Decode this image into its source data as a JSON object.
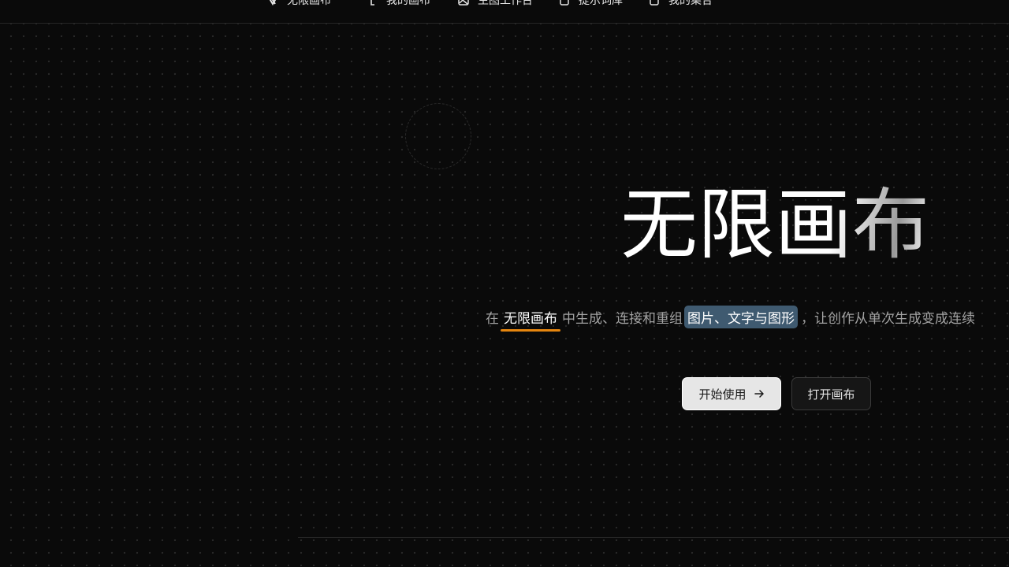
{
  "nav": {
    "items": [
      {
        "label": "无限画布",
        "icon": "logo-icon"
      },
      {
        "label": "我的画布",
        "icon": "bracket-icon"
      },
      {
        "label": "生图工作台",
        "icon": "image-icon"
      },
      {
        "label": "提示词库",
        "icon": "notebook-icon"
      },
      {
        "label": "我的集合",
        "icon": "clipboard-icon"
      }
    ]
  },
  "hero": {
    "title": "无限画布",
    "subtitle": {
      "prefix": "在",
      "highlight_underline": "无限画布",
      "middle": "中生成、连接和重组",
      "highlight_box": "图片、文字与图形",
      "suffix": "，让创作从单次生成变成连续"
    }
  },
  "actions": {
    "start_label": "开始使用",
    "start_icon": "arrow-right-icon",
    "open_canvas_label": "打开画布"
  },
  "colors": {
    "background": "#0a0a0a",
    "underline_accent": "#e6860f",
    "highlight_box": "#3f5a70",
    "primary_button": "#e6e6e6"
  }
}
